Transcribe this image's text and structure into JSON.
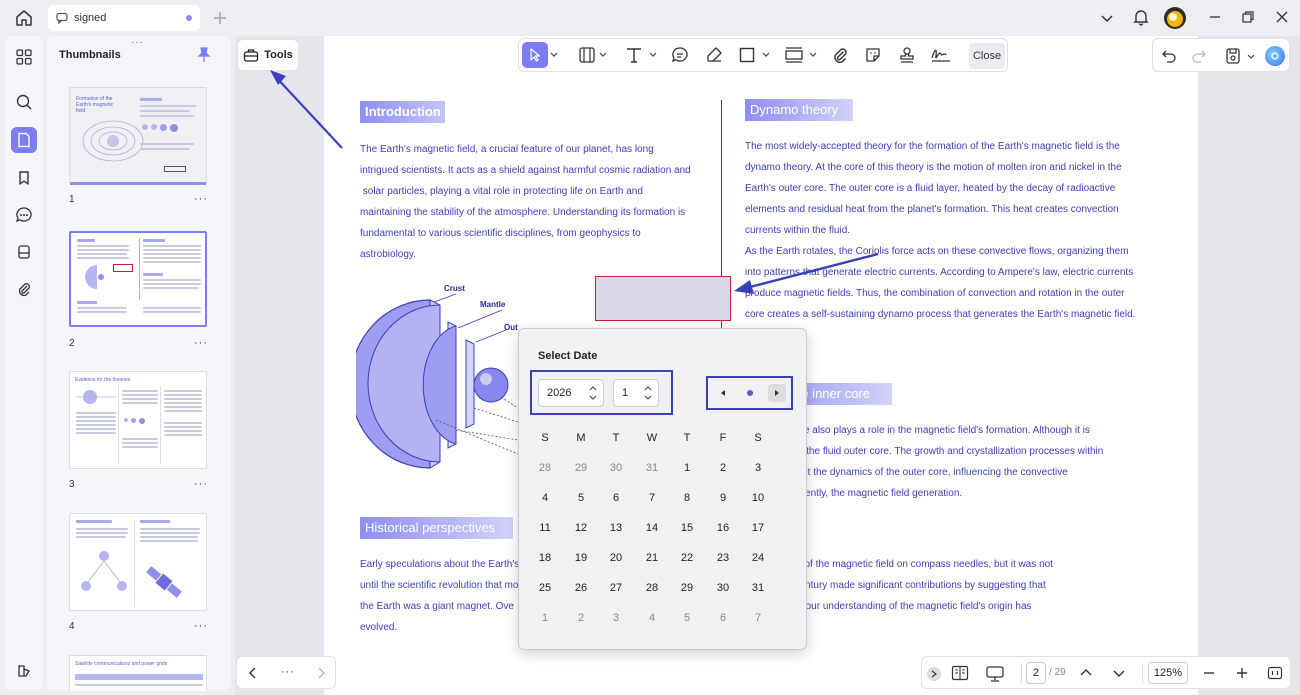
{
  "window": {
    "tab_title": "signed"
  },
  "thumbnails": {
    "title": "Thumbnails",
    "pages": [
      "1",
      "2",
      "3",
      "4"
    ],
    "more": "···",
    "thumb1_title": "Formation of the Earth's magnetic field",
    "thumb3_title": "Evidence for the theories",
    "thumb5_title": "Satellite communications and power grids"
  },
  "tools_label": "Tools",
  "toolbar": {
    "close_label": "Close"
  },
  "document": {
    "intro_heading": "Introduction",
    "intro_lines": [
      "The Earth's magnetic field, a crucial feature of our planet, has long",
      "intrigued scientists. It acts as a shield against harmful cosmic radiation and",
      " solar particles, playing a vital role in protecting life on Earth and",
      "maintaining the stability of the atmosphere. Understanding its formation is",
      "fundamental to various scientific disciplines, from geophysics to",
      "astrobiology."
    ],
    "diagram_labels": {
      "crust": "Crust",
      "mantle": "Mantle",
      "outer_core": "Outer Core"
    },
    "dynamo_heading": "Dynamo theory",
    "dynamo_lines": [
      "The most widely-accepted theory for the formation of the Earth's magnetic field is the",
      "dynamo theory. At the core of this theory is the motion of molten iron and nickel in the",
      "Earth's outer core. The outer core is a fluid layer, heated by the decay of radioactive",
      "elements and residual heat from the planet's formation. This heat creates convection",
      "currents within the fluid.",
      "As the Earth rotates, the Coriolis force acts on these convective flows, organizing them",
      "into patterns that generate electric currents. According to Ampere's law, electric currents",
      "produce magnetic fields. Thus, the combination of convection and rotation in the outer",
      "core creates a self-sustaining dynamo process that generates the Earth's magnetic field."
    ],
    "inner_core_heading": "The inner core",
    "inner_core_lines": [
      "The inner core also plays a role in the magnetic field's formation. Although it is",
      "interacts with the fluid outer core. The growth and crystallization processes within",
      "core can affect the dynamics of the outer core, influencing the convective",
      "and, consequently, the magnetic field generation."
    ],
    "history_heading": "Historical perspectives",
    "history_left": [
      "Early speculations about the Earth's",
      "until the scientific revolution that mo",
      "the Earth was a giant magnet. Ove",
      "evolved."
    ],
    "history_right": [
      "the influence of the magnetic field on compass needles, but it was not",
      "in the 17th century made significant contributions by suggesting that",
      "and theories, our understanding of the magnetic field's origin has"
    ]
  },
  "date_picker": {
    "title": "Select Date",
    "year": "2026",
    "month": "1",
    "weekdays": [
      "S",
      "M",
      "T",
      "W",
      "T",
      "F",
      "S"
    ],
    "weeks": [
      [
        "28",
        "29",
        "30",
        "31",
        "1",
        "2",
        "3"
      ],
      [
        "4",
        "5",
        "6",
        "7",
        "8",
        "9",
        "10"
      ],
      [
        "11",
        "12",
        "13",
        "14",
        "15",
        "16",
        "17"
      ],
      [
        "18",
        "19",
        "20",
        "21",
        "22",
        "23",
        "24"
      ],
      [
        "25",
        "26",
        "27",
        "28",
        "29",
        "30",
        "31"
      ],
      [
        "1",
        "2",
        "3",
        "4",
        "5",
        "6",
        "7"
      ]
    ]
  },
  "pager": {
    "more": "···",
    "current_page": "2",
    "total": "/ 29",
    "zoom": "125%"
  },
  "colors": {
    "accent": "#7c7cf4",
    "text_blue": "#3d3fb7",
    "arrow": "#3b3fb8",
    "highlight_box": "#c0203a"
  }
}
